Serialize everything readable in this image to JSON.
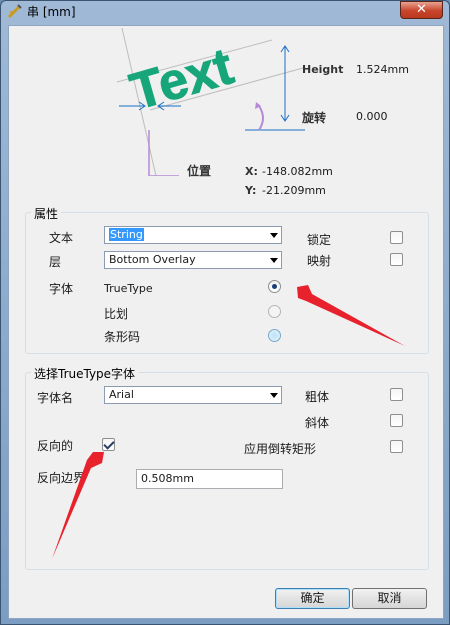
{
  "window": {
    "title": "串 [mm]",
    "close_glyph": "✕"
  },
  "preview": {
    "sample_text": "Text",
    "height_label": "Height",
    "height_value": "1.524mm",
    "rotation_label": "旋转",
    "rotation_value": "0.000",
    "location_label": "位置",
    "x_label": "X:",
    "x_value": "-148.082mm",
    "y_label": "Y:",
    "y_value": "-21.209mm"
  },
  "properties": {
    "group_title": "属性",
    "text_label": "文本",
    "text_value": "String",
    "layer_label": "层",
    "layer_value": "Bottom Overlay",
    "font_label": "字体",
    "font_options": [
      "TrueType",
      "比划",
      "条形码"
    ],
    "font_selected": "TrueType",
    "locked_label": "锁定",
    "locked": false,
    "mirror_label": "映射",
    "mirror": false
  },
  "truetype": {
    "group_title": "选择TrueType字体",
    "font_name_label": "字体名",
    "font_name_value": "Arial",
    "bold_label": "粗体",
    "bold": false,
    "italic_label": "斜体",
    "italic": false,
    "inverted_label": "反向的",
    "inverted": true,
    "use_inverted_rect_label": "应用倒转矩形",
    "use_inverted_rect": false,
    "inverted_border_label": "反向边界",
    "inverted_border_value": "0.508mm"
  },
  "buttons": {
    "ok": "确定",
    "cancel": "取消"
  },
  "colors": {
    "accent_text": "#1f5fb5",
    "text_sample": "#17a67a",
    "annotation_arrow": "#e8222c",
    "guide": "#1b6fc8",
    "location_marker": "#b58ad6"
  }
}
